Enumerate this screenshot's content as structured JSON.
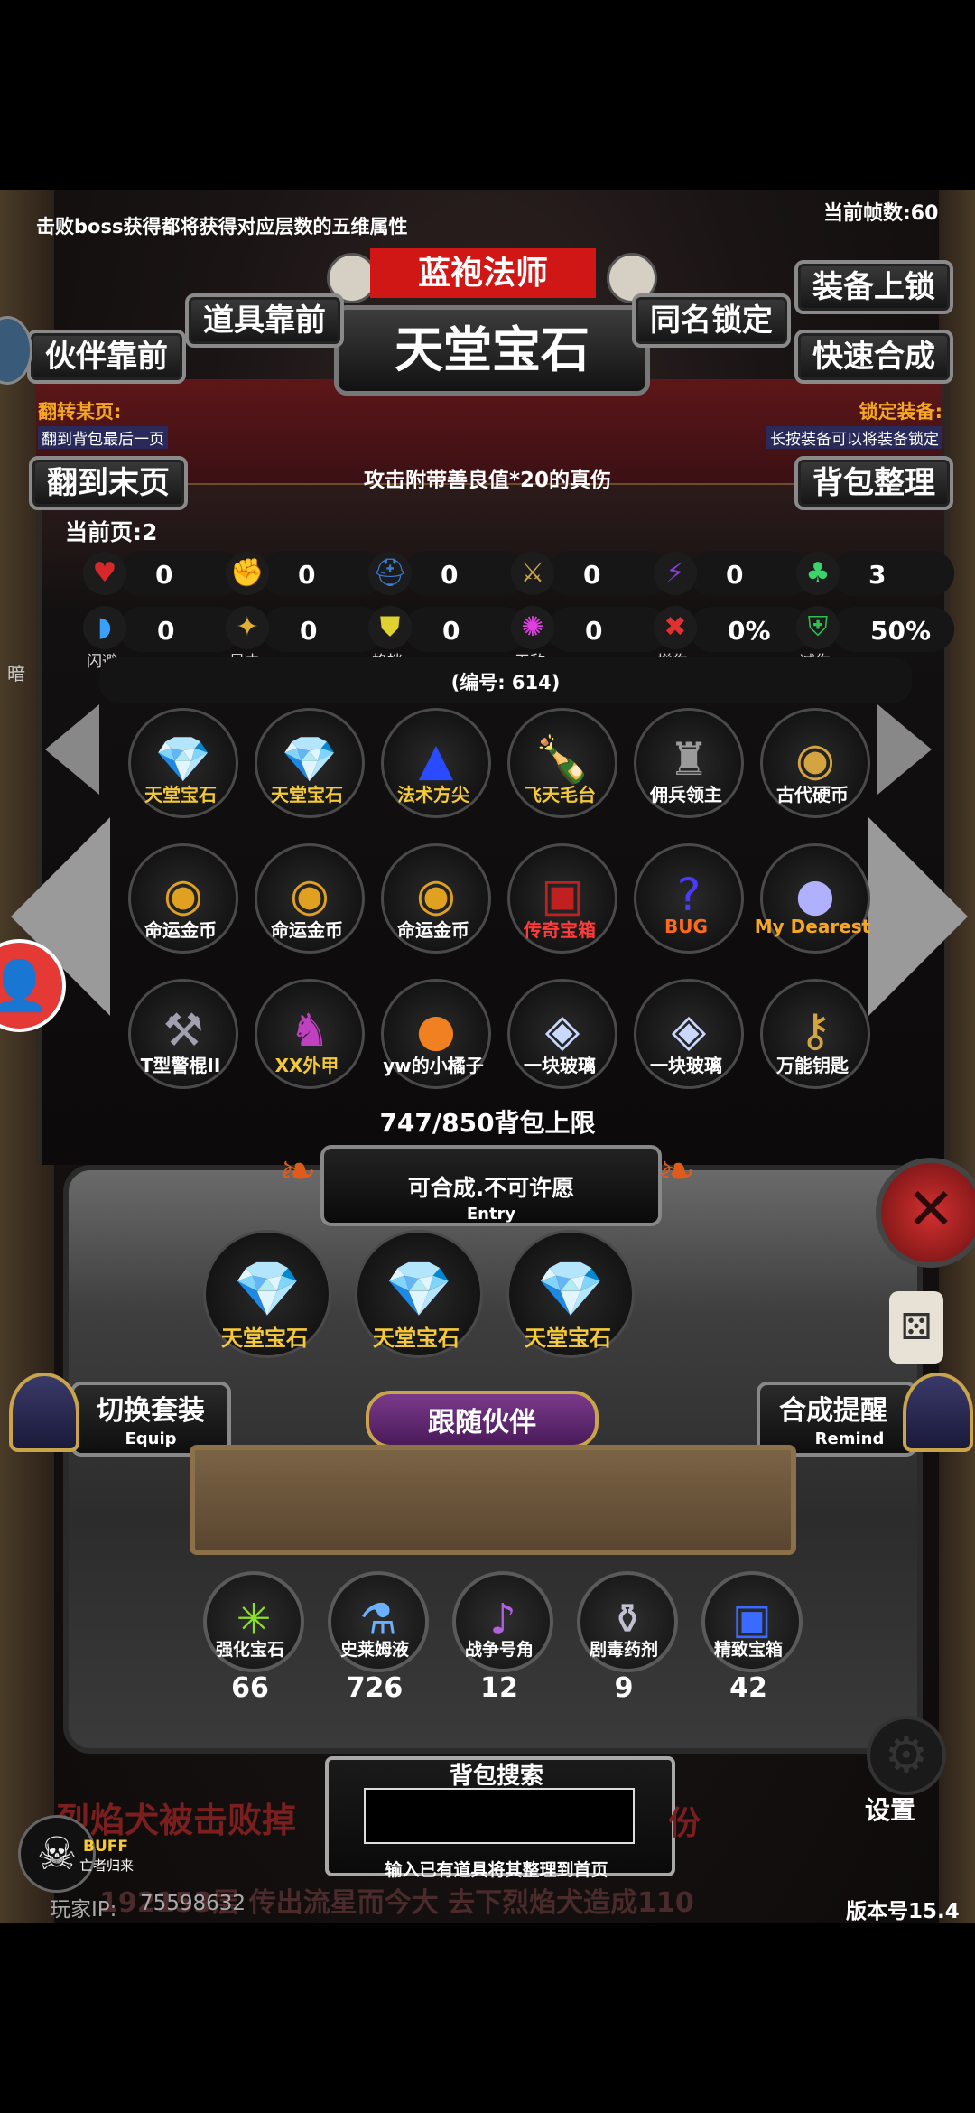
{
  "top_notice": "击败boss获得都将获得对应层数的五维属性",
  "fps": "当前帧数:60",
  "header": {
    "class_name": "蓝袍法师",
    "item_title": "天堂宝石",
    "btn_item_front": "道具靠前",
    "btn_partner_front": "伙伴靠前",
    "btn_same_lock": "同名锁定",
    "btn_equip_lock": "装备上锁",
    "btn_quick_merge": "快速合成"
  },
  "info": {
    "flip_label": "翻转某页:",
    "flip_hint": "翻到背包最后一页",
    "lock_label": "锁定装备:",
    "lock_hint": "长按装备可以将装备锁定",
    "btn_last_page": "翻到末页",
    "btn_sort": "背包整理",
    "description": "攻击附带善良值*20的真伤",
    "current_page": "当前页:2"
  },
  "stats_row1": [
    {
      "icon": "heart-icon",
      "glyph": "♥",
      "value": "0"
    },
    {
      "icon": "strength-icon",
      "glyph": "✊",
      "value": "0"
    },
    {
      "icon": "helmet-icon",
      "glyph": "⛑",
      "value": "0"
    },
    {
      "icon": "sword-icon",
      "glyph": "⚔",
      "value": "0"
    },
    {
      "icon": "lightning-icon",
      "glyph": "⚡",
      "value": "0"
    },
    {
      "icon": "clover-icon",
      "glyph": "♣",
      "value": "3"
    }
  ],
  "stats_row2": [
    {
      "icon": "dodge-icon",
      "glyph": "◗",
      "value": "0",
      "label": "闪避"
    },
    {
      "icon": "crit-icon",
      "glyph": "✦",
      "value": "0",
      "label": "暴击"
    },
    {
      "icon": "block-icon",
      "glyph": "⛊",
      "value": "0",
      "label": "格挡"
    },
    {
      "icon": "invincible-icon",
      "glyph": "✺",
      "value": "0",
      "label": "无敌"
    },
    {
      "icon": "damage-boost-icon",
      "glyph": "✖",
      "value": "0%",
      "label": "增伤"
    },
    {
      "icon": "damage-reduce-icon",
      "glyph": "⛨",
      "value": "50%",
      "label": "减伤"
    }
  ],
  "item_id": "(编号: 614)",
  "inventory": [
    {
      "name": "天堂宝石",
      "icon": "heaven-gem-icon",
      "glyph": "💎",
      "color": "#f5c93a"
    },
    {
      "name": "天堂宝石",
      "icon": "heaven-gem-icon",
      "glyph": "💎",
      "color": "#f5c93a"
    },
    {
      "name": "法术方尖",
      "icon": "obelisk-icon",
      "glyph": "▲",
      "color": "#f5c93a"
    },
    {
      "name": "飞天毛台",
      "icon": "bottle-icon",
      "glyph": "🍾",
      "color": "#f5c93a"
    },
    {
      "name": "佣兵领主",
      "icon": "knight-icon",
      "glyph": "♜",
      "color": "#ffffff"
    },
    {
      "name": "古代硬币",
      "icon": "coin-icon",
      "glyph": "◉",
      "color": "#ffffff"
    },
    {
      "name": "命运金币",
      "icon": "gold-coin-icon",
      "glyph": "◉",
      "color": "#ffffff"
    },
    {
      "name": "命运金币",
      "icon": "gold-coin-icon",
      "glyph": "◉",
      "color": "#ffffff"
    },
    {
      "name": "命运金币",
      "icon": "gold-coin-icon",
      "glyph": "◉",
      "color": "#ffffff"
    },
    {
      "name": "传奇宝箱",
      "icon": "legend-chest-icon",
      "glyph": "▣",
      "color": "#ff3b3b"
    },
    {
      "name": "BUG",
      "icon": "bug-icon",
      "glyph": "?",
      "color": "#ff6a1a"
    },
    {
      "name": "My Dearest",
      "icon": "orb-icon",
      "glyph": "●",
      "color": "#f5a623"
    },
    {
      "name": "T型警棍II",
      "icon": "baton-icon",
      "glyph": "⚒",
      "color": "#ffffff"
    },
    {
      "name": "XX外甲",
      "icon": "armor-icon",
      "glyph": "♞",
      "color": "#f5c93a"
    },
    {
      "name": "yw的小橘子",
      "icon": "orange-icon",
      "glyph": "●",
      "color": "#ffffff"
    },
    {
      "name": "一块玻璃",
      "icon": "glass-icon",
      "glyph": "◈",
      "color": "#ffffff"
    },
    {
      "name": "一块玻璃",
      "icon": "glass-icon",
      "glyph": "◈",
      "color": "#ffffff"
    },
    {
      "name": "万能钥匙",
      "icon": "key-icon",
      "glyph": "⚷",
      "color": "#ffffff"
    }
  ],
  "capacity": "747/850背包上限",
  "entry": {
    "title": "可合成.不可许愿",
    "sub": "Entry"
  },
  "entry_slots": [
    {
      "name": "天堂宝石",
      "icon": "heaven-gem-icon"
    },
    {
      "name": "天堂宝石",
      "icon": "heaven-gem-icon"
    },
    {
      "name": "天堂宝石",
      "icon": "heaven-gem-icon"
    }
  ],
  "equip_btn": {
    "title": "切换套装",
    "sub": "Equip"
  },
  "remind_btn": {
    "title": "合成提醒",
    "sub": "Remind"
  },
  "follow_btn": "跟随伙伴",
  "materials": [
    {
      "name": "强化宝石",
      "icon": "enhance-gem-icon",
      "glyph": "✳",
      "count": "66"
    },
    {
      "name": "史莱姆液",
      "icon": "potion-icon",
      "glyph": "⚗",
      "count": "726"
    },
    {
      "name": "战争号角",
      "icon": "horn-icon",
      "glyph": "♪",
      "count": "12"
    },
    {
      "name": "剧毒药剂",
      "icon": "poison-icon",
      "glyph": "⚱",
      "count": "9"
    },
    {
      "name": "精致宝箱",
      "icon": "chest-icon",
      "glyph": "▣",
      "count": "42"
    }
  ],
  "search": {
    "label": "背包搜索",
    "hint": "输入已有道具将其整理到首页",
    "value": ""
  },
  "chat_line1_left": "烈焰犬被击败掉",
  "chat_line1_right": "份",
  "chat_line2": "192153层 传出流星而今大 去下烈焰犬造成110",
  "buff": {
    "title": "BUFF",
    "sub": "亡者归来"
  },
  "settings": "设置",
  "player_ip_label": "玩家IP:",
  "player_ip": "75598632",
  "version": "版本号15.4",
  "side_label": "暗"
}
